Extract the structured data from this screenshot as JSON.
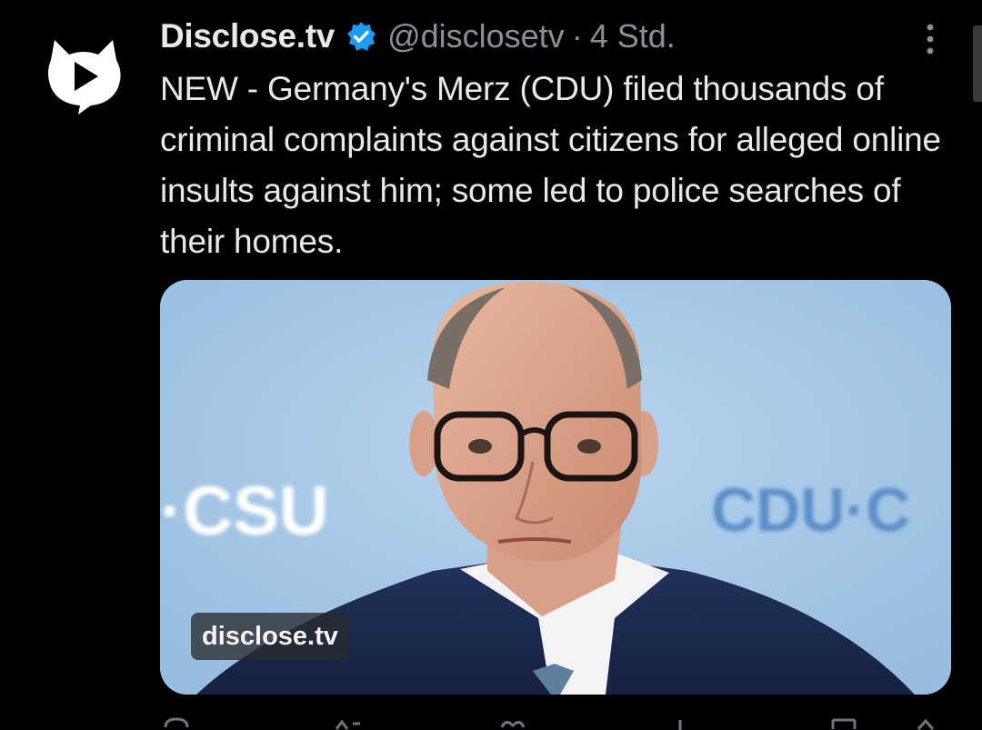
{
  "tweet": {
    "display_name": "Disclose.tv",
    "handle": "@disclosetv",
    "separator": "·",
    "time": "4 Std.",
    "text": "NEW - Germany's Merz (CDU) filed thousands of criminal complaints against citizens for alleged online insults against him; some led to police searches of their homes.",
    "verified_color": "#1d9bf0",
    "avatar_icon": "disclose-logo-icon",
    "more_icon": "more-vertical-icon"
  },
  "media": {
    "source_label": "disclose.tv",
    "backdrop_left_text": "·CSU",
    "backdrop_right_text": "CDU·C",
    "backdrop_color": "#a9c9e6",
    "logo_text_color": "#5b8fc9"
  },
  "actions": {
    "icons": [
      "reply-icon",
      "retweet-icon",
      "like-icon",
      "views-icon",
      "bookmark-icon",
      "share-icon"
    ]
  }
}
